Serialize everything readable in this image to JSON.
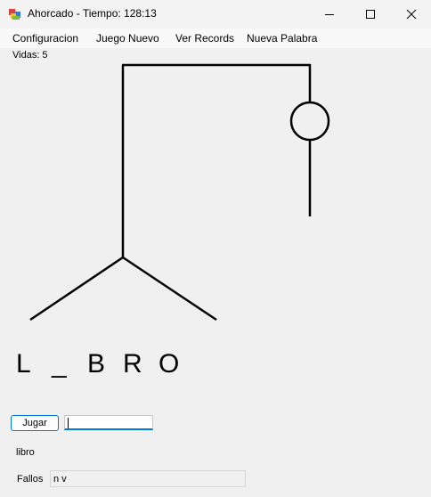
{
  "window": {
    "title": "Ahorcado - Tiempo: 128:13"
  },
  "menu": {
    "items": [
      {
        "label": "Configuracion"
      },
      {
        "label": "Juego Nuevo"
      },
      {
        "label": "Ver Records"
      },
      {
        "label": "Nueva Palabra"
      }
    ]
  },
  "game": {
    "lives_text": "Vidas: 5",
    "word_letters": [
      "L",
      "_",
      "B",
      "R",
      "O"
    ],
    "solution_text": "libro",
    "play_button_label": "Jugar",
    "letter_input_value": "",
    "misses_label": "Fallos",
    "misses_value": "n v"
  },
  "icons": {
    "app": "hangman-app-icon",
    "minimize": "minimize-icon",
    "maximize": "maximize-icon",
    "close": "close-icon"
  },
  "colors": {
    "accent": "#0078d4",
    "drawing": "#000000",
    "background": "#f0f0f0"
  }
}
